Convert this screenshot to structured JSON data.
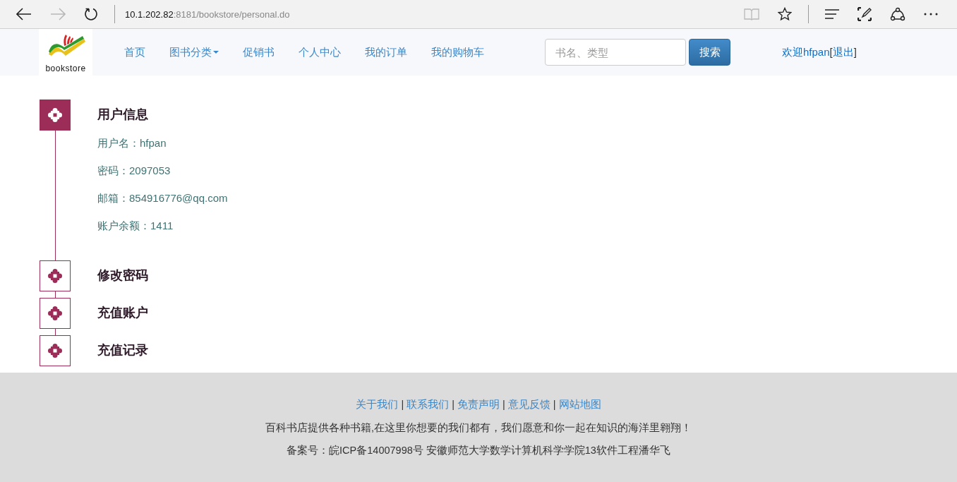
{
  "browser": {
    "back": {
      "disabled": false
    },
    "forward": {
      "disabled": true
    },
    "url_host": "10.1.202.82",
    "url_rest": ":8181/bookstore/personal.do",
    "reading_view": {
      "disabled": true
    }
  },
  "navbar": {
    "logo_text": "bookstore",
    "items": [
      {
        "label": "首页",
        "dropdown": false
      },
      {
        "label": "图书分类",
        "dropdown": true
      },
      {
        "label": "促销书",
        "dropdown": false
      },
      {
        "label": "个人中心",
        "dropdown": false
      },
      {
        "label": "我的订单",
        "dropdown": false
      },
      {
        "label": "我的购物车",
        "dropdown": false
      }
    ],
    "search": {
      "placeholder": "书名、类型",
      "button": "搜索"
    },
    "welcome": "欢迎hfpan",
    "bracket_open": "[",
    "logout": "退出",
    "bracket_close": "]"
  },
  "sections": [
    {
      "title": "用户信息",
      "expanded": true,
      "details": [
        "用户名：hfpan",
        "密码：2097053",
        "邮箱：854916776@qq.com",
        "账户余额：1411"
      ]
    },
    {
      "title": "修改密码",
      "expanded": false
    },
    {
      "title": "充值账户",
      "expanded": false
    },
    {
      "title": "充值记录",
      "expanded": false
    }
  ],
  "footer": {
    "links": [
      {
        "kind": "link",
        "text": "关于我们"
      },
      {
        "kind": "separator",
        "text": "|"
      },
      {
        "kind": "link",
        "text": "联系我们"
      },
      {
        "kind": "separator",
        "text": "|"
      },
      {
        "kind": "link",
        "text": "免责声明"
      },
      {
        "kind": "separator",
        "text": "|"
      },
      {
        "kind": "link",
        "text": "意见反馈"
      },
      {
        "kind": "separator",
        "text": "|"
      },
      {
        "kind": "link",
        "text": "网站地图"
      }
    ],
    "slogan": "百科书店提供各种书籍,在这里你想要的我们都有，我们愿意和你一起在知识的海洋里翱翔！",
    "record": "备案号：皖ICP备14007998号 安徽师范大学数学计算机科学学院13软件工程潘华飞"
  }
}
